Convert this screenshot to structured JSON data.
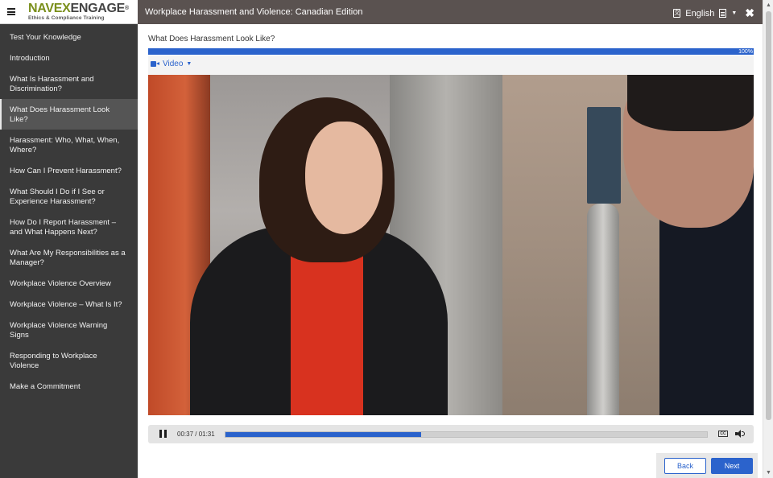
{
  "brand": {
    "logo_part1": "NAVEX",
    "logo_part2": "ENGAGE",
    "logo_registered": "®",
    "tagline": "Ethics & Compliance Training"
  },
  "header": {
    "course_title": "Workplace Harassment and Violence: Canadian Edition",
    "language": "English",
    "icons": [
      "menu-icon",
      "language-icon",
      "document-icon",
      "chevron-down-icon",
      "close-icon"
    ]
  },
  "sidebar": {
    "items": [
      {
        "label": "Test Your Knowledge"
      },
      {
        "label": "Introduction"
      },
      {
        "label": "What Is Harassment and Discrimination?"
      },
      {
        "label": "What Does Harassment Look Like?",
        "active": true
      },
      {
        "label": "Harassment: Who, What, When, Where?"
      },
      {
        "label": "How Can I Prevent Harassment?"
      },
      {
        "label": "What Should I Do if I See or Experience Harassment?"
      },
      {
        "label": "How Do I Report Harassment – and What Happens Next?"
      },
      {
        "label": "What Are My Responsibilities as a Manager?"
      },
      {
        "label": "Workplace Violence Overview"
      },
      {
        "label": "Workplace Violence – What Is It?"
      },
      {
        "label": "Workplace Violence Warning Signs"
      },
      {
        "label": "Responding to Workplace Violence"
      },
      {
        "label": "Make a Commitment"
      }
    ]
  },
  "main": {
    "page_title": "What Does Harassment Look Like?",
    "progress_label": "100%",
    "progress_fraction": 1.0,
    "media_tab": "Video"
  },
  "player": {
    "time": "00:37 / 01:31",
    "played_fraction": 0.4066,
    "cc_label": "CC"
  },
  "footer": {
    "back_label": "Back",
    "next_label": "Next"
  },
  "colors": {
    "accent": "#2b63cc",
    "topbar": "#5a5250",
    "sidebar": "#3a3a3a",
    "logo_green": "#7a8f1b"
  }
}
